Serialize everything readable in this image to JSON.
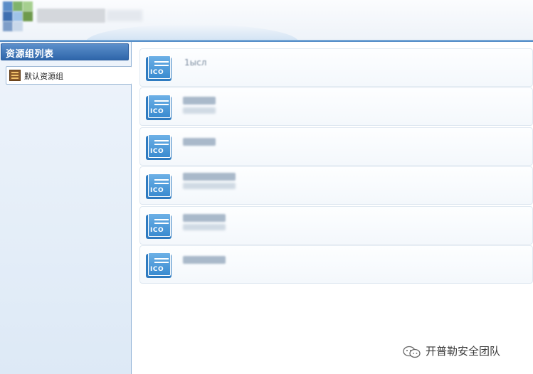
{
  "sidebar": {
    "title": "资源组列表",
    "items": [
      {
        "label": "默认资源组",
        "icon": "resource-group-icon"
      }
    ]
  },
  "main": {
    "rows": [
      {
        "icon": "ico-icon",
        "icon_text": "ICO",
        "name": "1ысл"
      },
      {
        "icon": "ico-icon",
        "icon_text": "ICO",
        "name": ""
      },
      {
        "icon": "ico-icon",
        "icon_text": "ICO",
        "name": ""
      },
      {
        "icon": "ico-icon",
        "icon_text": "ICO",
        "name": ""
      },
      {
        "icon": "ico-icon",
        "icon_text": "ICO",
        "name": ""
      },
      {
        "icon": "ico-icon",
        "icon_text": "ICO",
        "name": ""
      }
    ]
  },
  "watermark": {
    "text": "开普勒安全团队",
    "icon": "wechat-icon"
  },
  "colors": {
    "accent": "#2f66aa",
    "header_divider": "#4a86c4",
    "icon_blue": "#3a8bd0"
  }
}
